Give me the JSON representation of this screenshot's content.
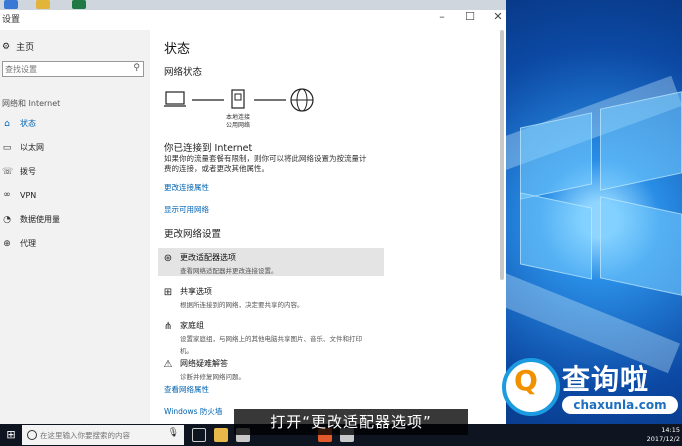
{
  "window": {
    "title": "设置",
    "controls": {
      "minimize": "–",
      "maximize": "☐",
      "close": "✕"
    }
  },
  "sidebar": {
    "home": "主页",
    "search_placeholder": "查找设置",
    "section": "网络和 Internet",
    "items": [
      {
        "label": "状态",
        "icon": "home-icon"
      },
      {
        "label": "以太网",
        "icon": "ethernet-icon"
      },
      {
        "label": "拨号",
        "icon": "dialup-icon"
      },
      {
        "label": "VPN",
        "icon": "vpn-icon"
      },
      {
        "label": "数据使用量",
        "icon": "data-usage-icon"
      },
      {
        "label": "代理",
        "icon": "globe-icon"
      }
    ]
  },
  "main": {
    "title": "状态",
    "network_status": "网络状态",
    "diagram_label_1": "本地连接",
    "diagram_label_2": "公用网络",
    "connected": "你已连接到 Internet",
    "desc_line1": "如果你的流量套餐有限制，则你可以将此网络设置为按流量计",
    "desc_line2": "费的连接，或者更改其他属性。",
    "link_change_props": "更改连接属性",
    "link_show_networks": "显示可用网络",
    "change_settings": "更改网络设置",
    "options": [
      {
        "title": "更改适配器选项",
        "desc": "查看网络适配器并更改连接设置。",
        "icon": "adapter-icon"
      },
      {
        "title": "共享选项",
        "desc": "根据所连接到的网络，决定要共享的内容。",
        "icon": "sharing-icon"
      },
      {
        "title": "家庭组",
        "desc": "设置家庭组，与网络上的其他电脑共享图片、音乐、文件和打印",
        "desc2": "机。",
        "icon": "homegroup-icon"
      },
      {
        "title": "网络疑难解答",
        "desc": "诊断并修复网络问题。",
        "icon": "warning-icon"
      }
    ],
    "link_view_props": "查看网络属性",
    "link_firewall": "Windows 防火墙"
  },
  "taskbar": {
    "search_placeholder": "在这里输入你要搜索的内容",
    "time": "14:15",
    "date": "2017/12/2"
  },
  "subtitle": "打开“更改适配器选项”",
  "watermark": {
    "cn": "查询啦",
    "en": "chaxunla.com",
    "q": "Q"
  },
  "colors": {
    "accent": "#0063b1",
    "taskbar": "#0e1420",
    "highlight": "#e4e4e4"
  }
}
